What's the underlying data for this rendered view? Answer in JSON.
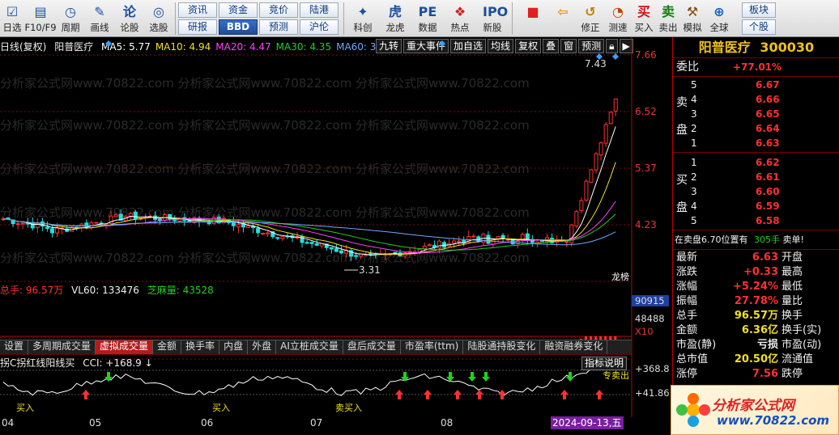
{
  "toolbar": {
    "items": [
      {
        "label": "日选",
        "icon": "checkbox-icon"
      },
      {
        "label": "F10/F9",
        "icon": "f10-icon"
      },
      {
        "label": "周期",
        "icon": "clock-icon"
      },
      {
        "label": "画线",
        "icon": "pen-icon"
      },
      {
        "label": "论股",
        "icon": "forum-icon"
      },
      {
        "label": "选股",
        "icon": "radar-icon"
      }
    ],
    "text_buttons": [
      [
        "资讯",
        "资金",
        "竞价",
        "陆港"
      ],
      [
        "研报",
        "BBD",
        "预测",
        "沪伦"
      ]
    ],
    "items2": [
      {
        "label": "科创",
        "icon": "star-chart-icon"
      },
      {
        "label": "龙虎",
        "icon": "tiger-icon"
      },
      {
        "label": "数据",
        "icon": "pe-icon"
      },
      {
        "label": "热点",
        "icon": "hot-icon"
      },
      {
        "label": "新股",
        "icon": "ipo-icon"
      }
    ],
    "items3": [
      {
        "label": "",
        "icon": "grid-color-icon"
      },
      {
        "label": "",
        "icon": "back-arrow-icon"
      },
      {
        "label": "修正",
        "icon": "revise-icon"
      },
      {
        "label": "测速",
        "icon": "speed-icon"
      },
      {
        "label": "买入",
        "icon": "buy-icon"
      },
      {
        "label": "卖出",
        "icon": "sell-icon"
      },
      {
        "label": "模拟",
        "icon": "hammer-icon"
      },
      {
        "label": "全球",
        "icon": "globe-icon"
      }
    ],
    "right_buttons": [
      "板块",
      "个股"
    ]
  },
  "chart": {
    "mode": "日线(复权)",
    "stock_name": "阳普医疗",
    "ma": [
      {
        "label": "MA5:",
        "value": "5.77",
        "color": "#ffffff"
      },
      {
        "label": "MA10:",
        "value": "4.94",
        "color": "#f0e020"
      },
      {
        "label": "MA20:",
        "value": "4.47",
        "color": "#ff40ff"
      },
      {
        "label": "MA30:",
        "value": "4.35",
        "color": "#20d020"
      },
      {
        "label": "MA60:",
        "value": "3.",
        "color": "#6fa8ff"
      }
    ],
    "buttons": [
      "九转",
      "重大事件",
      "加自选",
      "均线",
      "复权",
      "叠",
      "窗",
      "预测"
    ],
    "price_axis": [
      "7.66",
      "6.52",
      "5.37",
      "4.23"
    ],
    "high_label": "7.43",
    "low_label": "3.31",
    "event_label": "龙榜",
    "watermark": "分析家公式网www.70822.com"
  },
  "volume": {
    "label_total": "总手:",
    "total": "96.57万",
    "vl60_label": "VL60:",
    "vl60": "133476",
    "zhima_label": "芝麻量:",
    "zhima": "43528",
    "axis": [
      "90915",
      "48488",
      "X10"
    ]
  },
  "tabs": [
    "设置",
    "多周期成交量",
    "虚拟成交量",
    "金额",
    "换手率",
    "内盘",
    "外盘",
    "AI立桩成交量",
    "盘后成交量",
    "市盈率(ttm)",
    "陆股通持股变化",
    "融资融券变化"
  ],
  "active_tab": 2,
  "indicator": {
    "name": "拐C拐红线阳线买",
    "cci_label": "CCI:",
    "cci": "+168.9",
    "explain": "指标说明",
    "axis": [
      "+368.8",
      "+41.86"
    ],
    "signals": [
      "买入",
      "买入",
      "卖买入",
      "专卖出"
    ]
  },
  "dates": [
    "04",
    "05",
    "06",
    "07",
    "08"
  ],
  "cursor_date": "2024-09-13,五",
  "side": {
    "title": "阳普医疗",
    "code": "300030",
    "weibi_label": "委比",
    "weibi": "+77.01%",
    "sell_group_label": [
      "卖",
      "盘"
    ],
    "sell": [
      {
        "level": "5",
        "price": "6.67"
      },
      {
        "level": "4",
        "price": "6.66"
      },
      {
        "level": "3",
        "price": "6.65"
      },
      {
        "level": "2",
        "price": "6.64"
      },
      {
        "level": "1",
        "price": "6.63"
      }
    ],
    "buy_group_label": [
      "买",
      "盘"
    ],
    "buy": [
      {
        "level": "1",
        "price": "6.62"
      },
      {
        "level": "2",
        "price": "6.61"
      },
      {
        "level": "3",
        "price": "6.60"
      },
      {
        "level": "4",
        "price": "6.59"
      },
      {
        "level": "5",
        "price": "6.58"
      }
    ],
    "note_prefix": "在卖盘",
    "note_price": "6.70位置有",
    "note_qty": "305手",
    "note_suffix": "卖单!",
    "stats": [
      {
        "l1": "最新",
        "v1": "6.63",
        "c1": "red",
        "l2": "开盘"
      },
      {
        "l1": "涨跌",
        "v1": "+0.33",
        "c1": "red",
        "l2": "最高"
      },
      {
        "l1": "涨幅",
        "v1": "+5.24%",
        "c1": "red",
        "l2": "最低"
      },
      {
        "l1": "振幅",
        "v1": "27.78%",
        "c1": "red",
        "l2": "量比"
      },
      {
        "l1": "总手",
        "v1": "96.57万",
        "c1": "yellow",
        "l2": "换手"
      },
      {
        "l1": "金额",
        "v1": "6.36亿",
        "c1": "yellow",
        "l2": "换手(实)"
      },
      {
        "l1": "市盈(静)",
        "v1": "亏损",
        "c1": "white",
        "l2": "市盈(动)"
      },
      {
        "l1": "总市值",
        "v1": "20.50亿",
        "c1": "yellow",
        "l2": "流通值"
      },
      {
        "l1": "涨停",
        "v1": "7.56",
        "c1": "red",
        "l2": "跌停"
      }
    ]
  },
  "logo": {
    "text": "分析家公式网",
    "url": "www.70822.com"
  }
}
